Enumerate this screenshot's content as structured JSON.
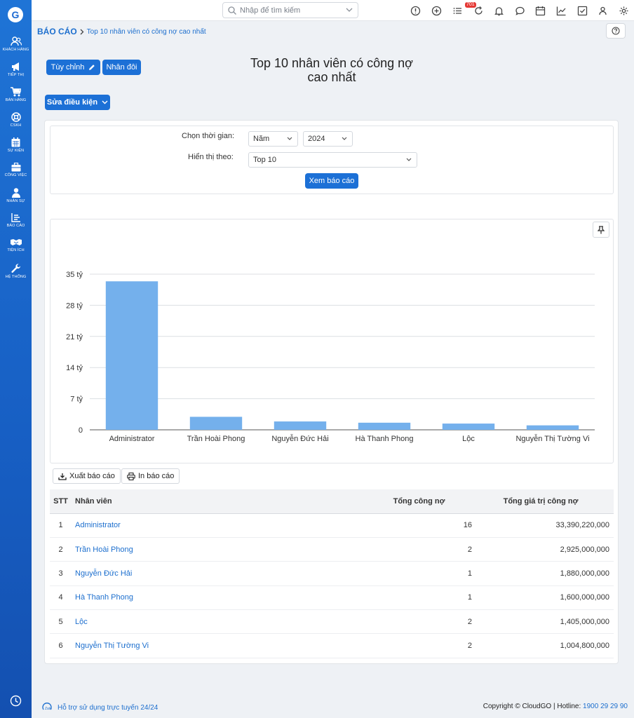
{
  "sidebar": {
    "items": [
      {
        "label": "KHÁCH HÀNG",
        "icon": "users-icon"
      },
      {
        "label": "TIẾP THỊ",
        "icon": "megaphone-icon"
      },
      {
        "label": "BÁN HÀNG",
        "icon": "cart-icon"
      },
      {
        "label": "CSKH",
        "icon": "lifebuoy-icon"
      },
      {
        "label": "SỰ KIỆN",
        "icon": "calendar-icon"
      },
      {
        "label": "CÔNG VIỆC",
        "icon": "briefcase-icon"
      },
      {
        "label": "NHÂN SỰ",
        "icon": "person-icon"
      },
      {
        "label": "BÁO CÁO",
        "icon": "report-icon"
      },
      {
        "label": "TIỆN ÍCH",
        "icon": "handshake-icon"
      },
      {
        "label": "HỆ THỐNG",
        "icon": "wrench-icon"
      }
    ]
  },
  "topbar": {
    "search_placeholder": "Nhập để tìm kiếm",
    "notification_count": "701"
  },
  "breadcrumb": {
    "root": "BÁO CÁO",
    "current": "Top 10 nhân viên có công nợ cao nhất"
  },
  "toolbar": {
    "customize_label": "Tùy chỉnh",
    "duplicate_label": "Nhân đôi",
    "edit_conditions_label": "Sửa điều kiện"
  },
  "page_title_line1": "Top 10 nhân viên có công nợ",
  "page_title_line2": "cao nhất",
  "filter": {
    "time_label": "Chọn thời gian:",
    "period_value": "Năm",
    "year_value": "2024",
    "display_label": "Hiển thị theo:",
    "display_value": "Top 10",
    "view_button": "Xem báo cáo"
  },
  "chart_data": {
    "type": "bar",
    "categories": [
      "Administrator",
      "Trần Hoài Phong",
      "Nguyễn Đức Hải",
      "Hà Thanh Phong",
      "Lộc",
      "Nguyễn Thị Tường Vi"
    ],
    "values": [
      33390220000,
      2925000000,
      1880000000,
      1600000000,
      1405000000,
      1004800000
    ],
    "ylim": [
      0,
      35000000000
    ],
    "yticks": [
      {
        "value": 0,
        "label": "0"
      },
      {
        "value": 7000000000,
        "label": "7 tỷ"
      },
      {
        "value": 14000000000,
        "label": "14 tỷ"
      },
      {
        "value": 21000000000,
        "label": "21 tỷ"
      },
      {
        "value": 28000000000,
        "label": "28 tỷ"
      },
      {
        "value": 35000000000,
        "label": "35 tỷ"
      }
    ],
    "bar_color": "#74b0ec",
    "grid": true,
    "title": "",
    "xlabel": "",
    "ylabel": ""
  },
  "actions": {
    "export_label": "Xuất báo cáo",
    "print_label": "In báo cáo"
  },
  "table": {
    "headers": [
      "STT",
      "Nhân viên",
      "Tổng công nợ",
      "Tổng giá trị công nợ"
    ],
    "rows": [
      {
        "stt": "1",
        "name": "Administrator",
        "count": "16",
        "value": "33,390,220,000"
      },
      {
        "stt": "2",
        "name": "Trần Hoài Phong",
        "count": "2",
        "value": "2,925,000,000"
      },
      {
        "stt": "3",
        "name": "Nguyễn Đức Hải",
        "count": "1",
        "value": "1,880,000,000"
      },
      {
        "stt": "4",
        "name": "Hà Thanh Phong",
        "count": "1",
        "value": "1,600,000,000"
      },
      {
        "stt": "5",
        "name": "Lộc",
        "count": "2",
        "value": "1,405,000,000"
      },
      {
        "stt": "6",
        "name": "Nguyễn Thị Tường Vi",
        "count": "2",
        "value": "1,004,800,000"
      }
    ]
  },
  "footer": {
    "support": "Hỗ trợ sử dụng trực tuyến 24/24",
    "copyright": "Copyright © CloudGO",
    "hotline_label": "Hotline:",
    "hotline": "1900 29 29 90"
  },
  "colors": {
    "sidebar": "#1f74d6",
    "accent": "#1c70d6",
    "link": "#1d6fce"
  }
}
